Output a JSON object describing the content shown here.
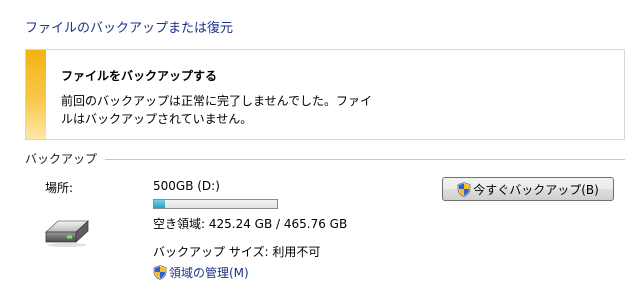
{
  "header": {
    "title": "ファイルのバックアップまたは復元"
  },
  "warning": {
    "heading": "ファイルをバックアップする",
    "message": "前回のバックアップは正常に完了しませんでした。ファイルはバックアップされていません。",
    "accent_color": "#f4b214"
  },
  "backup_section": {
    "title": "バックアップ",
    "location_label": "場所:",
    "drive": {
      "name": "500GB (D:)",
      "icon": "hard-drive-icon",
      "free_space_text": "空き領域: 425.24 GB / 465.76 GB",
      "used_fraction": 0.087,
      "usage_bar_color": "#2a9fc2"
    },
    "backup_size_text": "バックアップ サイズ: 利用不可",
    "manage_space_link": "領域の管理(M)",
    "backup_now_button": "今すぐバックアップ(B)",
    "shield_icon": "uac-shield-icon"
  }
}
